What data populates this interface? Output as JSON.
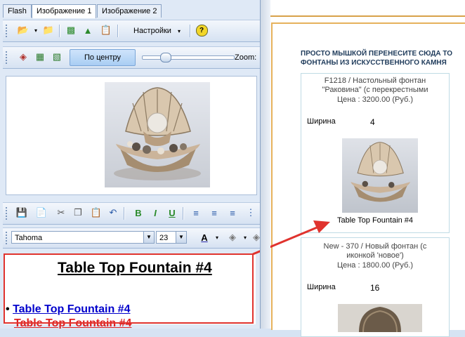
{
  "tabs": [
    "Flash",
    "Изображение 1",
    "Изображение 2"
  ],
  "toolbar1": {
    "settings_label": "Настройки"
  },
  "toolbar2": {
    "center_label": "По центру",
    "zoom_label": "Zoom:"
  },
  "format_toolbar": {
    "font_name": "Tahoma",
    "font_size": "23",
    "bold": "B",
    "italic": "I",
    "underline": "U",
    "color_letter": "A"
  },
  "editor": {
    "heading": "Table Top Fountain #4",
    "link1": "Table Top Fountain #4",
    "link2": "Table Top Fountain #4"
  },
  "page": {
    "instruction": "ПРОСТО МЫШКОЙ ПЕРЕНЕСИТЕ СЮДА ТО",
    "category": "ФОНТАНЫ ИЗ ИСКУССТВЕННОГО КАМНЯ",
    "products": [
      {
        "title_line1": "F1218 / Настольный фонтан",
        "title_line2": "\"Раковина\" (с перекрестными",
        "price": "Цена : 3200.00 (Руб.)",
        "width_label": "Ширина",
        "width_value": "4",
        "caption": "Table Top Fountain #4"
      },
      {
        "title_line1": "New - 370 / Новый фонтан (с",
        "title_line2": "иконкой 'новое')",
        "price": "Цена : 1800.00 (Руб.)",
        "width_label": "Ширина",
        "width_value": "16"
      }
    ]
  },
  "colors": {
    "highlight": "#e0332e",
    "link": "#0000cc",
    "link_visited": "#dd2222",
    "accent": "#e6b25c"
  }
}
